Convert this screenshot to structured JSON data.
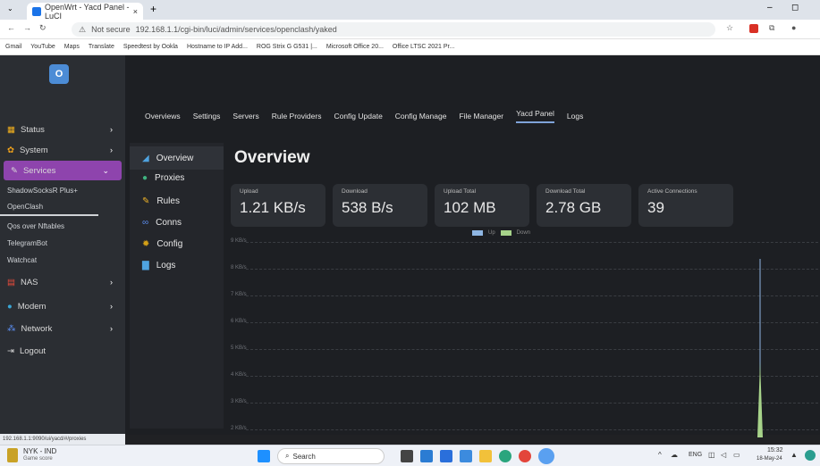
{
  "browser": {
    "tab_title": "OpenWrt - Yacd Panel - LuCI",
    "security": "Not secure",
    "url": "192.168.1.1/cgi-bin/luci/admin/services/openclash/yaked",
    "bookmarks": [
      "Gmail",
      "YouTube",
      "Maps",
      "Translate",
      "Speedtest by Ookla",
      "Hostname to IP Add...",
      "ROG Strix G G531 |...",
      "Microsoft Office 20...",
      "Office LTSC 2021 Pr..."
    ],
    "status_url": "192.168.1.1:9090/ui/yacd/#/proxies"
  },
  "sidebar": {
    "logo": "O",
    "items": [
      {
        "label": "Status",
        "icon": "chart-icon",
        "caret": "›"
      },
      {
        "label": "System",
        "icon": "gear-icon",
        "caret": "›"
      },
      {
        "label": "Services",
        "icon": "services-icon",
        "caret": "⌄"
      },
      {
        "label": "NAS",
        "icon": "nas-icon",
        "caret": "›"
      },
      {
        "label": "Modem",
        "icon": "modem-icon",
        "caret": "›"
      },
      {
        "label": "Network",
        "icon": "network-icon",
        "caret": "›"
      },
      {
        "label": "Logout",
        "icon": "logout-icon",
        "caret": ""
      }
    ],
    "services_sub": [
      "ShadowSocksR Plus+",
      "OpenClash",
      "Qos over Nftables",
      "TelegramBot",
      "Watchcat"
    ]
  },
  "topnav": [
    "Overviews",
    "Settings",
    "Servers",
    "Rule Providers",
    "Config Update",
    "Config Manage",
    "File Manager",
    "Yacd Panel",
    "Logs"
  ],
  "yacd": {
    "menu": [
      "Overview",
      "Proxies",
      "Rules",
      "Conns",
      "Config",
      "Logs"
    ],
    "title": "Overview",
    "cards": [
      {
        "label": "Upload",
        "value": "1.21 KB/s"
      },
      {
        "label": "Download",
        "value": "538 B/s"
      },
      {
        "label": "Upload Total",
        "value": "102 MB"
      },
      {
        "label": "Download Total",
        "value": "2.78 GB"
      },
      {
        "label": "Active Connections",
        "value": "39"
      }
    ],
    "legend": [
      "Up",
      "Down"
    ],
    "y_labels": [
      "9 KB/s",
      "8 KB/s",
      "7 KB/s",
      "6 KB/s",
      "5 KB/s",
      "4 KB/s",
      "3 KB/s",
      "2 KB/s"
    ]
  },
  "taskbar": {
    "weather_title": "NYK - IND",
    "weather_sub": "Game score",
    "search": "Search",
    "lang": "ENG",
    "time": "15:32",
    "date": "18-May-24"
  },
  "colors": {
    "accent": "#7fa3d9",
    "up": "#8fb6e3",
    "down": "#a7d38a"
  }
}
